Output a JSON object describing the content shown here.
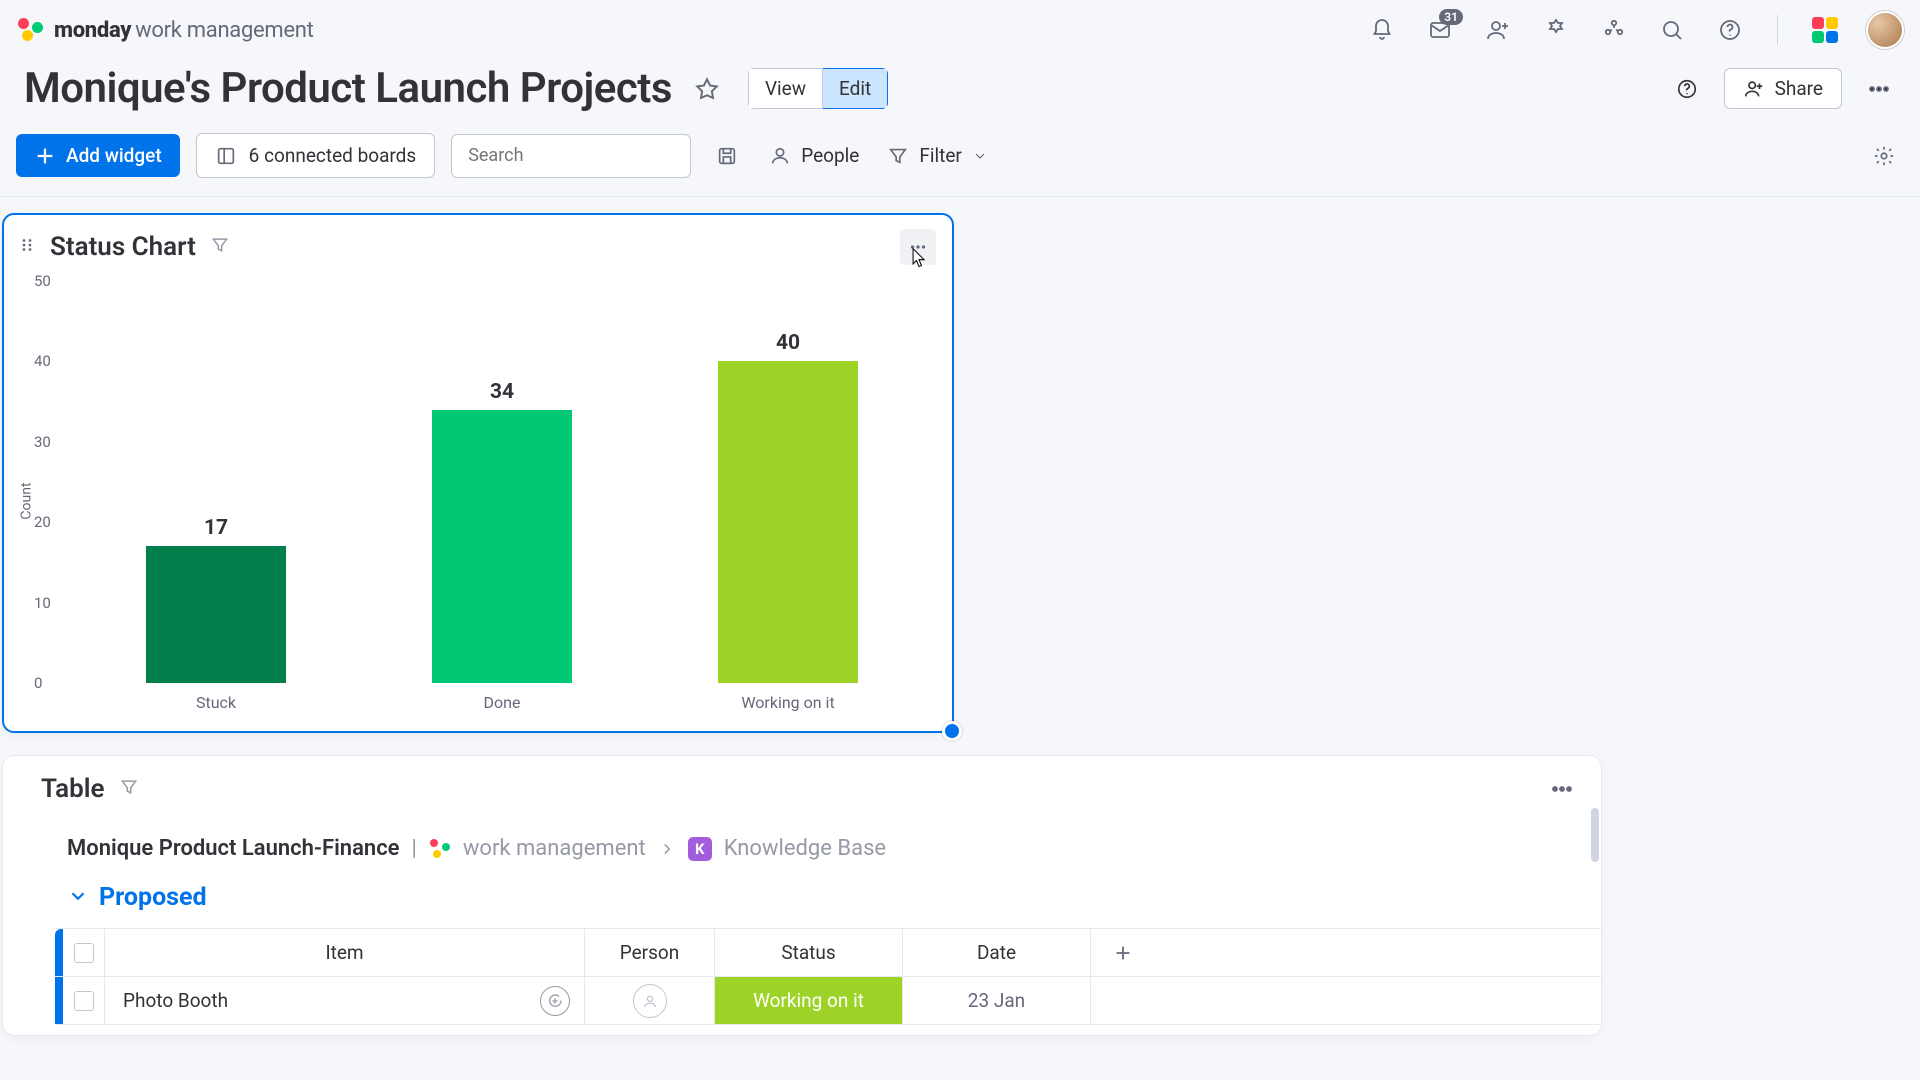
{
  "brand": {
    "bold": "monday",
    "light": "work management"
  },
  "topnav": {
    "inbox_badge": "31"
  },
  "header": {
    "title": "Monique's Product Launch Projects",
    "view_label": "View",
    "edit_label": "Edit",
    "share_label": "Share"
  },
  "toolbar": {
    "add_widget": "Add widget",
    "boards": "6 connected boards",
    "search_placeholder": "Search",
    "people": "People",
    "filter": "Filter"
  },
  "chart_widget": {
    "title": "Status Chart"
  },
  "chart_data": {
    "type": "bar",
    "title": "Status Chart",
    "ylabel": "Count",
    "xlabel": "",
    "ylim": [
      0,
      50
    ],
    "yticks": [
      0,
      10,
      20,
      30,
      40,
      50
    ],
    "categories": [
      "Stuck",
      "Done",
      "Working on it"
    ],
    "values": [
      17,
      34,
      40
    ],
    "colors": [
      "#037f4c",
      "#00c875",
      "#9cd326"
    ]
  },
  "table_widget": {
    "title": "Table",
    "breadcrumb": {
      "main": "Monique Product Launch-Finance",
      "workspace": "work management",
      "folder_initial": "K",
      "folder": "Knowledge Base"
    },
    "group": "Proposed",
    "columns": {
      "item": "Item",
      "person": "Person",
      "status": "Status",
      "date": "Date"
    },
    "rows": [
      {
        "item": "Photo Booth",
        "status": "Working on it",
        "status_color": "#9cd326",
        "date": "23 Jan"
      }
    ]
  }
}
